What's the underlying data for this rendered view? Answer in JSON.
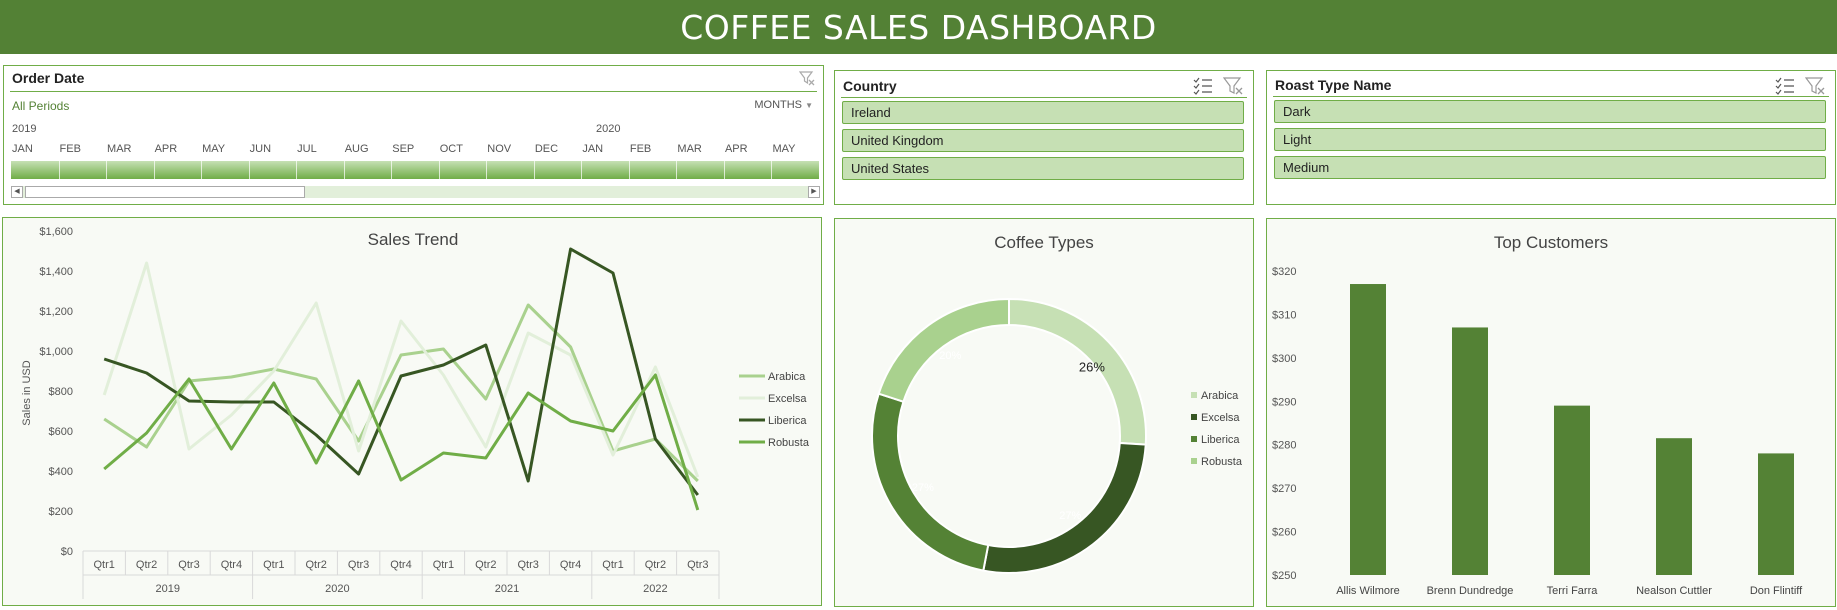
{
  "header": {
    "title": "COFFEE SALES DASHBOARD"
  },
  "colors": {
    "header_bg": "#538135",
    "border": "#70ad47",
    "slicer_item_bg": "#c6e0b4",
    "arabica": "#a9d18e",
    "excelsa": "#e2efda",
    "liberica": "#375623",
    "robusta": "#70ad47"
  },
  "timeline": {
    "title": "Order Date",
    "period": "All Periods",
    "level": "MONTHS",
    "years": [
      "2019",
      "2020"
    ],
    "months": [
      "JAN",
      "FEB",
      "MAR",
      "APR",
      "MAY",
      "JUN",
      "JUL",
      "AUG",
      "SEP",
      "OCT",
      "NOV",
      "DEC",
      "JAN",
      "FEB",
      "MAR",
      "APR",
      "MAY"
    ]
  },
  "country_slicer": {
    "title": "Country",
    "items": [
      "Ireland",
      "United Kingdom",
      "United States"
    ]
  },
  "roast_slicer": {
    "title": "Roast Type Name",
    "items": [
      "Dark",
      "Light",
      "Medium"
    ]
  },
  "sales_trend": {
    "title": "Sales Trend",
    "ylabel": "Sales in USD",
    "yticks": [
      "$0",
      "$200",
      "$400",
      "$600",
      "$800",
      "$1,000",
      "$1,200",
      "$1,400",
      "$1,600"
    ],
    "chart_data": {
      "type": "line",
      "title": "Sales Trend",
      "ylabel": "Sales in USD",
      "ylim": [
        0,
        1600
      ],
      "x_quarters": [
        "Qtr1",
        "Qtr2",
        "Qtr3",
        "Qtr4",
        "Qtr1",
        "Qtr2",
        "Qtr3",
        "Qtr4",
        "Qtr1",
        "Qtr2",
        "Qtr3",
        "Qtr4",
        "Qtr1",
        "Qtr2",
        "Qtr3"
      ],
      "x_years": [
        "2019",
        "2020",
        "2021",
        "2022"
      ],
      "series": [
        {
          "name": "Arabica",
          "color": "#a9d18e",
          "values": [
            660,
            520,
            850,
            870,
            910,
            860,
            550,
            980,
            1010,
            760,
            1230,
            1020,
            500,
            560,
            350
          ]
        },
        {
          "name": "Excelsa",
          "color": "#e2efda",
          "values": [
            780,
            1440,
            510,
            680,
            900,
            1240,
            500,
            1150,
            880,
            520,
            1090,
            980,
            480,
            920,
            370
          ]
        },
        {
          "name": "Liberica",
          "color": "#375623",
          "values": [
            960,
            890,
            750,
            745,
            745,
            580,
            385,
            875,
            930,
            1030,
            350,
            1510,
            1390,
            560,
            280
          ]
        },
        {
          "name": "Robusta",
          "color": "#70ad47",
          "values": [
            410,
            590,
            860,
            510,
            840,
            440,
            850,
            355,
            490,
            465,
            790,
            650,
            600,
            880,
            205
          ]
        }
      ]
    }
  },
  "coffee_types": {
    "title": "Coffee Types",
    "chart_data": {
      "type": "pie",
      "title": "Coffee Types",
      "donut": true,
      "slices": [
        {
          "name": "Arabica",
          "value": 26,
          "label": "26%",
          "color": "#c6e0b4"
        },
        {
          "name": "Excelsa",
          "value": 27,
          "label": "27%",
          "color": "#375623"
        },
        {
          "name": "Liberica",
          "value": 27,
          "label": "27%",
          "color": "#548235"
        },
        {
          "name": "Robusta",
          "value": 20,
          "label": "20%",
          "color": "#a9d18e"
        }
      ],
      "legend": [
        "Arabica",
        "Excelsa",
        "Liberica",
        "Robusta"
      ],
      "legend_placement": "right"
    }
  },
  "top_customers": {
    "title": "Top Customers",
    "yticks": [
      "$250",
      "$260",
      "$270",
      "$280",
      "$290",
      "$300",
      "$310",
      "$320"
    ],
    "chart_data": {
      "type": "bar",
      "title": "Top Customers",
      "categories": [
        "Allis Wilmore",
        "Brenn Dundredge",
        "Terri Farra",
        "Nealson Cuttler",
        "Don Flintiff"
      ],
      "values": [
        317,
        307,
        289,
        281.5,
        278
      ],
      "ylim": [
        250,
        320
      ],
      "color": "#548235"
    }
  }
}
